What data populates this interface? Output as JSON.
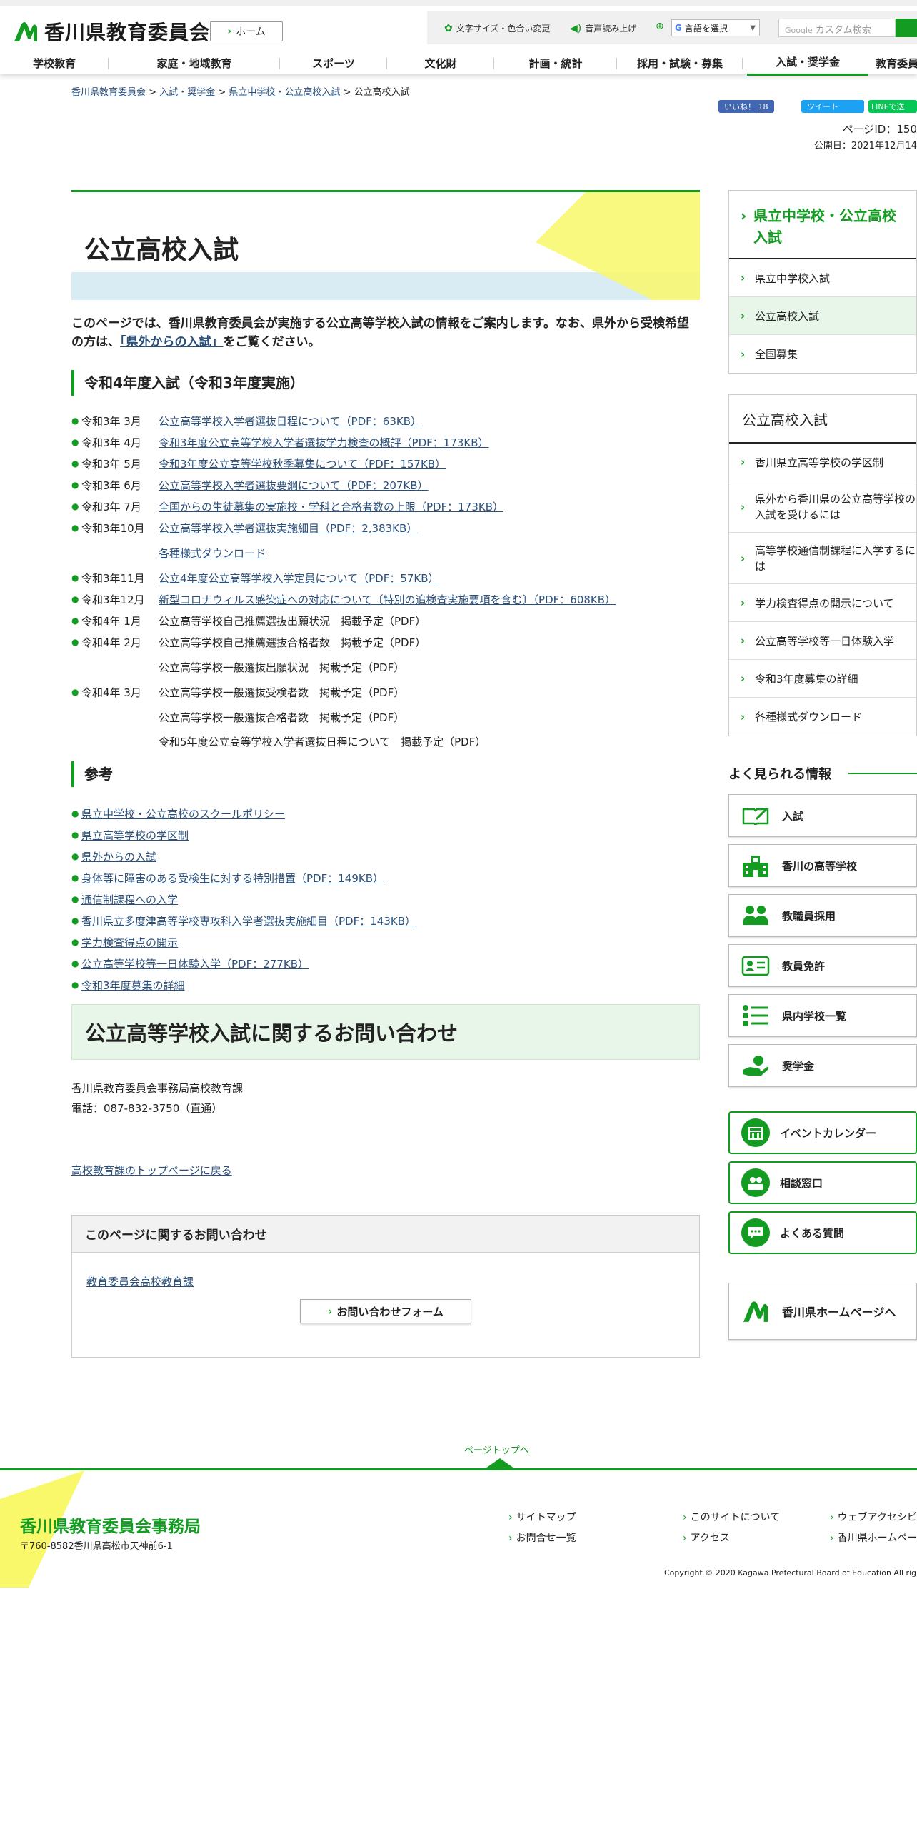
{
  "header": {
    "site_title": "香川県教育委員会",
    "home_label": "ホーム",
    "font_color_label": "文字サイズ・色合い変更",
    "read_aloud_label": "音声読み上げ",
    "language_label": "言語を選択",
    "search_placeholder": "カスタム検索",
    "search_brand": "Google"
  },
  "gnav": [
    "学校教育",
    "家庭・地域教育",
    "スポーツ",
    "文化財",
    "計画・統計",
    "採用・試験・募集",
    "入試・奨学金",
    "教育委員"
  ],
  "breadcrumb": {
    "items": [
      "香川県教育委員会",
      "入試・奨学金",
      "県立中学校・公立高校入試"
    ],
    "sep": ">",
    "current": "公立高校入試"
  },
  "social": {
    "like_label": "いいね！ 18",
    "tweet_label": "ツイート",
    "line_label": "LINEで送"
  },
  "page_meta": {
    "page_id": "ページID：150",
    "published": "公開日：2021年12月14"
  },
  "main": {
    "title": "公立高校入試",
    "lead_before": "このページでは、香川県教育委員会が実施する公立高等学校入試の情報をご案内します。なお、県外から受検希望の方は、",
    "lead_link": "「県外からの入試」",
    "lead_after": "をご覧ください。",
    "section1_title": "令和4年度入試（令和3年度実施）",
    "schedule": [
      {
        "date": "令和3年  3月",
        "text": "公立高等学校入学者選抜日程について（PDF：63KB）",
        "link": true
      },
      {
        "date": "令和3年  4月",
        "text": "令和3年度公立高等学校入学者選抜学力検査の概評（PDF：173KB）",
        "link": true
      },
      {
        "date": "令和3年  5月",
        "text": "令和3年度公立高等学校秋季募集について（PDF：157KB）",
        "link": true
      },
      {
        "date": "令和3年  6月",
        "text": "公立高等学校入学者選抜要綱について（PDF：207KB）",
        "link": true
      },
      {
        "date": "令和3年  7月",
        "text": "全国からの生徒募集の実施校・学科と合格者数の上限（PDF：173KB）",
        "link": true
      },
      {
        "date": "令和3年10月",
        "text": "公立高等学校入学者選抜実施細目（PDF：2,383KB）",
        "link": true
      },
      {
        "date": "",
        "text": "各種様式ダウンロード",
        "link": true
      },
      {
        "date": "令和3年11月",
        "text": "公立4年度公立高等学校入学定員について（PDF：57KB）",
        "link": true
      },
      {
        "date": "令和3年12月",
        "text": "新型コロナウィルス感染症への対応について〔特別の追検査実施要項を含む〕（PDF：608KB）",
        "link": true
      },
      {
        "date": "令和4年  1月",
        "text": "公立高等学校自己推薦選抜出願状況　掲載予定（PDF）",
        "link": false
      },
      {
        "date": "令和4年  2月",
        "text": "公立高等学校自己推薦選抜合格者数　掲載予定（PDF）",
        "link": false
      },
      {
        "date": "",
        "text": "公立高等学校一般選抜出願状況　掲載予定（PDF）",
        "link": false
      },
      {
        "date": "令和4年  3月",
        "text": "公立高等学校一般選抜受検者数　掲載予定（PDF）",
        "link": false
      },
      {
        "date": "",
        "text": "公立高等学校一般選抜合格者数　掲載予定（PDF）",
        "link": false
      },
      {
        "date": "",
        "text": "令和5年度公立高等学校入学者選抜日程について　掲載予定（PDF）",
        "link": false
      }
    ],
    "section2_title": "参考",
    "references": [
      "県立中学校・公立高校のスクールポリシー",
      "県立高等学校の学区制",
      "県外からの入試",
      "身体等に障害のある受検生に対する特別措置（PDF：149KB）",
      "通信制課程への入学",
      "香川県立多度津高等学校専攻科入学者選抜実施細目（PDF：143KB）",
      "学力検査得点の開示",
      "公立高等学校等一日体験入学（PDF：277KB）",
      "令和3年度募集の詳細"
    ],
    "inquiry_title": "公立高等学校入試に関するお問い合わせ",
    "contact_org": "香川県教育委員会事務局高校教育課",
    "contact_tel": "電話：087-832-3750（直通）",
    "back_link": "高校教育課のトップページに戻る",
    "inq_box_title": "このページに関するお問い合わせ",
    "inq_box_dept": "教育委員会高校教育課",
    "inq_form_label": "お問い合わせフォーム"
  },
  "sidebar": {
    "local_nav_title": "県立中学校・公立高校入試",
    "local_nav_items": [
      "県立中学校入試",
      "公立高校入試",
      "全国募集"
    ],
    "section_title": "公立高校入試",
    "section_items": [
      "香川県立高等学校の学区制",
      "県外から香川県の公立高等学校の入試を受けるには",
      "高等学校通信制課程に入学するには",
      "学力検査得点の開示について",
      "公立高等学校等一日体験入学",
      "令和3年度募集の詳細",
      "各種様式ダウンロード"
    ],
    "popular_title": "よく見られる情報",
    "popular_items": [
      "入試",
      "香川の高等学校",
      "教職員採用",
      "教員免許",
      "県内学校一覧",
      "奨学金"
    ],
    "green_items": [
      "イベントカレンダー",
      "相談窓口",
      "よくある質問"
    ],
    "pref_link": "香川県ホームページへ"
  },
  "footer": {
    "page_top": "ページトップへ",
    "org_name": "香川県教育委員会事務局",
    "address": "〒760-8582香川県高松市天神前6-1",
    "links": [
      "サイトマップ",
      "お問合せ一覧",
      "このサイトについて",
      "アクセス",
      "ウェブアクセシビ",
      "香川県ホームペー"
    ],
    "copyright": "Copyright © 2020 Kagawa Prefectural Board of Education All righ"
  },
  "colors": {
    "brand_green": "#139b22",
    "title_yellow": "#f8f86a",
    "band_blue": "#d9ecf3",
    "inquiry_bg": "#e8f5e9"
  }
}
